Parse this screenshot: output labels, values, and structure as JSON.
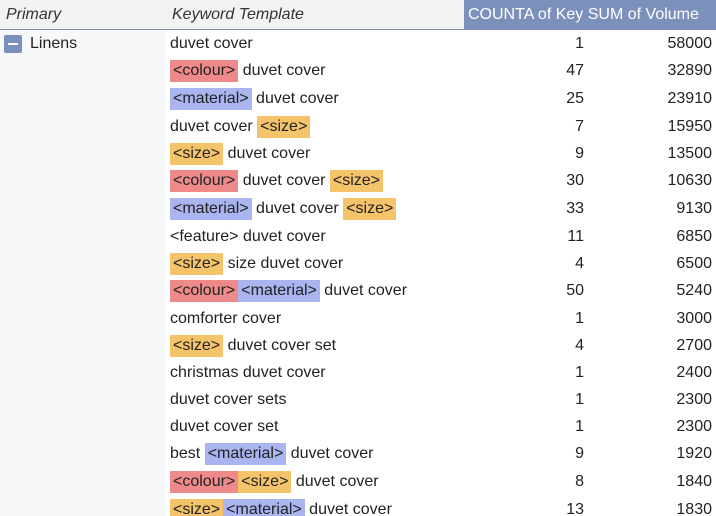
{
  "header": {
    "primary": "Primary",
    "keyword_template": "Keyword Template",
    "values": "COUNTA of Key SUM of Volume"
  },
  "group": {
    "label": "Linens"
  },
  "colors": {
    "colour_tag": "#ef8a8a",
    "material_tag": "#aab4ef",
    "size_tag": "#f5c36a",
    "values_header": "#7b90ba"
  },
  "rows": [
    {
      "parts": [
        {
          "t": "duvet cover",
          "c": ""
        }
      ],
      "count": "1",
      "volume": "58000"
    },
    {
      "parts": [
        {
          "t": "<colour>",
          "c": "colour"
        },
        {
          "t": " duvet cover",
          "c": ""
        }
      ],
      "count": "47",
      "volume": "32890"
    },
    {
      "parts": [
        {
          "t": "<material>",
          "c": "material"
        },
        {
          "t": " duvet cover",
          "c": ""
        }
      ],
      "count": "25",
      "volume": "23910"
    },
    {
      "parts": [
        {
          "t": "duvet cover ",
          "c": ""
        },
        {
          "t": "<size>",
          "c": "size"
        }
      ],
      "count": "7",
      "volume": "15950"
    },
    {
      "parts": [
        {
          "t": "<size>",
          "c": "size"
        },
        {
          "t": " duvet cover",
          "c": ""
        }
      ],
      "count": "9",
      "volume": "13500"
    },
    {
      "parts": [
        {
          "t": "<colour>",
          "c": "colour"
        },
        {
          "t": " duvet cover ",
          "c": ""
        },
        {
          "t": "<size>",
          "c": "size"
        }
      ],
      "count": "30",
      "volume": "10630"
    },
    {
      "parts": [
        {
          "t": "<material>",
          "c": "material"
        },
        {
          "t": " duvet cover ",
          "c": ""
        },
        {
          "t": "<size>",
          "c": "size"
        }
      ],
      "count": "33",
      "volume": "9130"
    },
    {
      "parts": [
        {
          "t": "<feature> duvet cover",
          "c": ""
        }
      ],
      "count": "11",
      "volume": "6850"
    },
    {
      "parts": [
        {
          "t": "<size>",
          "c": "size"
        },
        {
          "t": " size duvet cover",
          "c": ""
        }
      ],
      "count": "4",
      "volume": "6500"
    },
    {
      "parts": [
        {
          "t": "<colour>",
          "c": "colour"
        },
        {
          "t": "<material>",
          "c": "material"
        },
        {
          "t": " duvet cover",
          "c": ""
        }
      ],
      "count": "50",
      "volume": "5240"
    },
    {
      "parts": [
        {
          "t": "comforter cover",
          "c": ""
        }
      ],
      "count": "1",
      "volume": "3000"
    },
    {
      "parts": [
        {
          "t": "<size>",
          "c": "size"
        },
        {
          "t": " duvet cover set",
          "c": ""
        }
      ],
      "count": "4",
      "volume": "2700"
    },
    {
      "parts": [
        {
          "t": "christmas duvet cover",
          "c": ""
        }
      ],
      "count": "1",
      "volume": "2400"
    },
    {
      "parts": [
        {
          "t": "duvet cover sets",
          "c": ""
        }
      ],
      "count": "1",
      "volume": "2300"
    },
    {
      "parts": [
        {
          "t": "duvet cover set",
          "c": ""
        }
      ],
      "count": "1",
      "volume": "2300"
    },
    {
      "parts": [
        {
          "t": "best ",
          "c": ""
        },
        {
          "t": "<material>",
          "c": "material"
        },
        {
          "t": " duvet cover",
          "c": ""
        }
      ],
      "count": "9",
      "volume": "1920"
    },
    {
      "parts": [
        {
          "t": "<colour>",
          "c": "colour"
        },
        {
          "t": "<size>",
          "c": "size"
        },
        {
          "t": " duvet cover",
          "c": ""
        }
      ],
      "count": "8",
      "volume": "1840"
    },
    {
      "parts": [
        {
          "t": "<size>",
          "c": "size"
        },
        {
          "t": "<material>",
          "c": "material"
        },
        {
          "t": " duvet cover",
          "c": ""
        }
      ],
      "count": "13",
      "volume": "1830"
    }
  ]
}
